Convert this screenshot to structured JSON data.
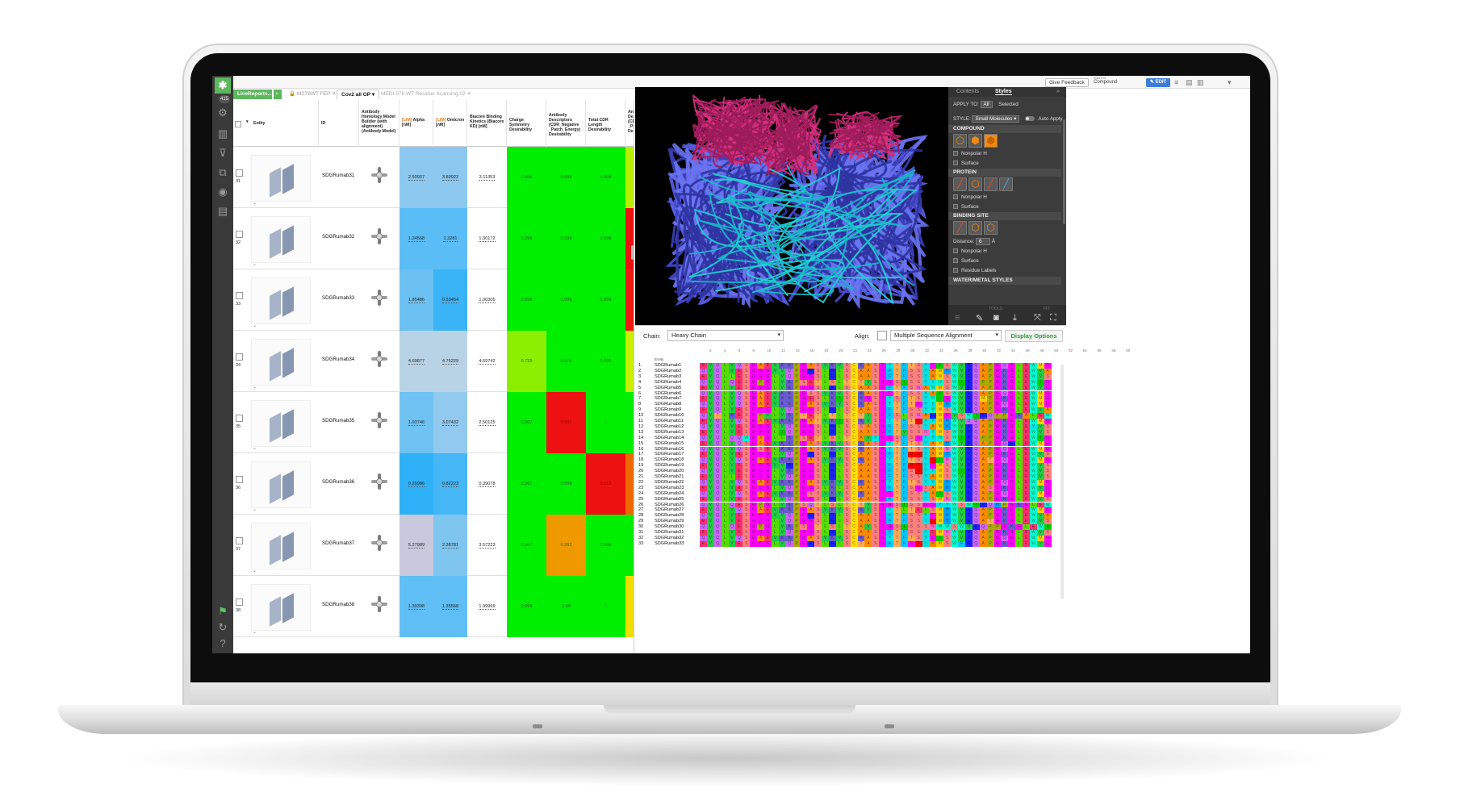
{
  "app": {
    "rail_badge": "415",
    "give_feedback": "Give Feedback",
    "row_for_label": "Row For",
    "row_for_value": "Compound",
    "edit_label": "✎ EDIT"
  },
  "tabs": [
    {
      "label": "LiveReports..."
    },
    {
      "label": "+"
    },
    {
      "label": "🔒 MS78WT FEP ✕"
    },
    {
      "label": "Cov2 all GP ▾"
    },
    {
      "label": "MEDI-578 WT Residue Scanning 02 ✕"
    }
  ],
  "table": {
    "columns": [
      {
        "label": "Entity"
      },
      {
        "label": "ID"
      },
      {
        "label": "Antibody Homology Model Builder (with alignment) (Antibody Model)"
      },
      {
        "label_hl": "[LiM]",
        "label": "Alpha [nM]"
      },
      {
        "label_hl": "[LiM]",
        "label": "Omicron [nM]"
      },
      {
        "label": "Biacore Binding Kinetics (Biacore KD) [nM]"
      },
      {
        "label": "Charge Symmetry Desirability"
      },
      {
        "label": "Antibody Descriptors (CDR_Negative _Patch_Energy) Desirability"
      },
      {
        "label": "Total CDR Length Desirability"
      },
      {
        "label": "Antibody Descriptors (CDR_Positive _Patch_Energy) Desirability"
      }
    ],
    "rows": [
      {
        "num": "31",
        "id": "SDGRumab31",
        "alpha": "2.50937",
        "omicron": "3.89922",
        "kd": "3.11353",
        "charge": "0.985",
        "neg": "0.885",
        "cdr": "0.998",
        "pos": "0.642",
        "c_alpha": "#8cc8f0",
        "c_omicron": "#8cc8f0",
        "c_charge": "#00ee00",
        "c_neg": "#00ee00",
        "c_cdr": "#00ee00",
        "c_pos": "#b8ee00"
      },
      {
        "num": "32",
        "id": "SDGRumab32",
        "alpha": "1.24568",
        "omicron": "1.3281",
        "kd": "1.30172",
        "charge": "0.996",
        "neg": "0.999",
        "cdr": "0.998",
        "pos": "0.01",
        "c_alpha": "#5bbdf5",
        "c_omicron": "#5bbdf5",
        "c_charge": "#00ee00",
        "c_neg": "#00ee00",
        "c_cdr": "#00ee00",
        "c_pos": "#ee1111"
      },
      {
        "num": "33",
        "id": "SDGRumab33",
        "alpha": "1.85486",
        "omicron": "0.53454",
        "kd": "1.00305",
        "charge": "0.996",
        "neg": "0.996",
        "cdr": "0.999",
        "pos": "0.087",
        "c_alpha": "#6bc1f2",
        "c_omicron": "#3ab4f7",
        "c_charge": "#00ee00",
        "c_neg": "#00ee00",
        "c_cdr": "#00ee00",
        "c_pos": "#ee1a11"
      },
      {
        "num": "34",
        "id": "SDGRumab34",
        "alpha": "4.69877",
        "omicron": "4.76229",
        "kd": "4.69742",
        "charge": "0.729",
        "neg": "0.976",
        "cdr": "0.996",
        "pos": "0.804",
        "c_alpha": "#b9d3e6",
        "c_omicron": "#b9d3e6",
        "c_charge": "#8cee00",
        "c_neg": "#00ee00",
        "c_cdr": "#00ee00",
        "c_pos": "#c8ee00"
      },
      {
        "num": "35",
        "id": "SDGRumab35",
        "alpha": "1.93746",
        "omicron": "3.07432",
        "kd": "2.50125",
        "charge": "0.967",
        "neg": "0.001",
        "cdr": "1",
        "pos": "0.983",
        "c_alpha": "#6fc2f2",
        "c_omicron": "#92c9ee",
        "c_charge": "#00ee00",
        "c_neg": "#ee1111",
        "c_cdr": "#00ee00",
        "c_pos": "#00ee00"
      },
      {
        "num": "36",
        "id": "SDGRumab36",
        "alpha": "0.29986",
        "omicron": "0.82223",
        "kd": "0.39078",
        "charge": "0.967",
        "neg": "0.898",
        "cdr": "0.012",
        "pos": "0.221",
        "c_alpha": "#2fb1f8",
        "c_omicron": "#45b7f6",
        "c_charge": "#00ee00",
        "c_neg": "#00ee00",
        "c_cdr": "#ee1111",
        "c_pos": "#ee6a00"
      },
      {
        "num": "37",
        "id": "SDGRumab37",
        "alpha": "5.27989",
        "omicron": "2.38781",
        "kd": "3.57223",
        "charge": "0.967",
        "neg": "0.292",
        "cdr": "0.995",
        "pos": "0.995",
        "c_alpha": "#c9c9de",
        "c_omicron": "#7ec5f0",
        "c_charge": "#00ee00",
        "c_neg": "#ee9900",
        "c_cdr": "#00ee00",
        "c_pos": "#00ee00"
      },
      {
        "num": "38",
        "id": "SDGRumab38",
        "alpha": "1.39398",
        "omicron": "1.35568",
        "kd": "1.99969",
        "charge": "0.999",
        "neg": "0.99",
        "cdr": "1",
        "pos": "0.424",
        "c_alpha": "#5fbef4",
        "c_omicron": "#5fbef4",
        "c_charge": "#00ee00",
        "c_neg": "#00ee00",
        "c_cdr": "#00ee00",
        "c_pos": "#eedd00"
      }
    ]
  },
  "panel": {
    "tab_contents": "Contents",
    "tab_styles": "Styles",
    "apply_to": "APPLY TO:",
    "apply_all": "All",
    "apply_selected": "Selected",
    "style_label": "STYLE:",
    "style_value": "Small Molecules ▾",
    "auto_apply": "Auto Apply",
    "sec_compound": "COMPOUND",
    "nonpolar_h": "Nonpolar H",
    "surface": "Surface",
    "sec_protein": "PROTEIN",
    "sec_binding": "BINDING SITE",
    "distance_label": "Distance:",
    "distance_value": "6",
    "distance_unit": "Å",
    "residue_labels": "Residue Labels",
    "sec_water": "WATER/METAL STYLES",
    "tools_label": "TOOLS:",
    "fit_label": "FIT:"
  },
  "sequence": {
    "chain_label": "Chain:",
    "chain_value": "Heavy Chain",
    "align_label": "Align:",
    "align_value": "Multiple Sequence Alignment",
    "display_options": "Display Options",
    "entity_header": "Entity",
    "ruler": [
      "2",
      "4",
      "6",
      "8",
      "10",
      "12",
      "14",
      "16",
      "18",
      "20",
      "22",
      "24",
      "26",
      "28",
      "30",
      "32",
      "34",
      "36",
      "38",
      "40",
      "42",
      "44",
      "46",
      "48",
      "50",
      "52",
      "54",
      "56",
      "58",
      "60"
    ],
    "palette": {
      "A": "#ff8c00",
      "C": "#ffe000",
      "D": "#ff0000",
      "E": "#ff3070",
      "F": "#00c8ff",
      "G": "#ff00ff",
      "H": "#00a0ff",
      "I": "#00cc00",
      "K": "#6a5acd",
      "L": "#55dd00",
      "M": "#ffd000",
      "N": "#ff66cc",
      "P": "#aaaa00",
      "Q": "#cc66ff",
      "R": "#1e22ff",
      "S": "#ff7f7f",
      "T": "#ffaa55",
      "V": "#22cc44",
      "W": "#00ffcc",
      "Y": "#00e5e5"
    },
    "rows": [
      {
        "n": "1",
        "name": "SDGRumab1",
        "seq": "EVQLVQSGAEVKKPGASVKVSCKASGYTFTSYGISWVRQAPGQGLEWMGWISAYNGNTNY"
      },
      {
        "n": "2",
        "name": "SDGRumab2",
        "seq": "QVQLVESGGGVVQPGRSLRLSCAASGFTFSSYAMHWVRQAPGKGLEWVAVISYDGSNKYY"
      },
      {
        "n": "3",
        "name": "SDGRumab3",
        "seq": "EVQLLESGGGLVQPGGSLRLSCAASGFTFSSYAMSWVRQAPGKGLEWVSAISGSGGSTYY"
      },
      {
        "n": "4",
        "name": "SDGRumab4",
        "seq": "QVQLQESGPGLVKPSETLSLTCTVSGGSISSYYWSWIRQPPGKGLEWIGYIYYSGSTNYN"
      },
      {
        "n": "5",
        "name": "SDGRumab5",
        "seq": "EVQLVESGGGLVKPGGSLRLSCAASGFTFSNAWMSWVRQAPGKGLEWVGRIKSKTDGGTT"
      },
      {
        "n": "6",
        "name": "SDGRumab6",
        "seq": "QVQLVQSGAEVKKPGSSVKVSCKASGGTFSSYAISWVRQAPGQGLEWMGGIIPIFGTANY"
      },
      {
        "n": "7",
        "name": "SDGRumab7",
        "seq": "EVQLVQSGAEVKKPGESLKISCKGSGYSFTSYWIGWVRQMPGKGLEWMGIIYPGDSDTRY"
      },
      {
        "n": "8",
        "name": "SDGRumab8",
        "seq": "QVQLVQSGAEVKKPGASVKVSCKASGYTFTGYYMHWVRQAPGQGLEWMGWINPNSGGTNY"
      },
      {
        "n": "9",
        "name": "SDGRumab9",
        "seq": "EVQLVESGGGLVQPGGSLRLSCAASGFTFSSYWMSWVRQAPGKGLEWVANIKQDGSEKYY"
      },
      {
        "n": "10",
        "name": "SDGRumab10",
        "seq": "QVTLKESGPVLVKPTETLTLTCTVSGFSLSNARMGVSWIRQPPGKALEWLAHIFSNDEKS"
      },
      {
        "n": "11",
        "name": "SDGRumab11",
        "seq": "EVQLVQSGAEVKKPGATVKISCKVSGYTFTDYYMHWVQQAPGKGLEWMGLVDPEDGETIY"
      },
      {
        "n": "12",
        "name": "SDGRumab12",
        "seq": "QVQLVESGGGLVQPGGSLRLSCSASGFTFSSYAMHWVRQAPGKGLEYVSAISSNGGSTYY"
      },
      {
        "n": "13",
        "name": "SDGRumab13",
        "seq": "EVQLVESGGGLIQPGGSLRLSCAASGFTVSSNYMSWVRQAPGKGLEWVSVIYSGGSTYYA"
      },
      {
        "n": "14",
        "name": "SDGRumab14",
        "seq": "QVQLQQWGAGLLKPSETLSLTCAVYGGSFSGYYWSWIRQPPGKGLEWIGEINHSGSTNYN"
      },
      {
        "n": "15",
        "name": "SDGRumab15",
        "seq": "EVQLVQSGAEVKKPGASVKVSCKASGYTFTSYAMHWVRQAPGQRLEWMGWINAGNGNTKY"
      },
      {
        "n": "16",
        "name": "SDGRumab16",
        "seq": "QVQLVQSGSELKKPGASVKVSCKASGYTFTSYAMNWVRQAPGQGLEWMGWINTNTGNPTY"
      },
      {
        "n": "17",
        "name": "SDGRumab17",
        "seq": "EVQLVESGGGLVQPGRSLRLSCAASGFTFDDYAMHWVRQAPGKGLEWVSGISWNSGSIGY"
      },
      {
        "n": "18",
        "name": "SDGRumab18",
        "seq": "QVQLVQSGAEVKKPGASVKVSCKASGYTFTSYDINWVRQATGQGLEWMGWMNPNSGNTGY"
      },
      {
        "n": "19",
        "name": "SDGRumab19",
        "seq": "EVQLVESGGGVVRPGGSLRLSCAASGFTFDDYGMSWVRQAPGKGLEWVSGINWNGGSTGY"
      },
      {
        "n": "20",
        "name": "SDGRumab20",
        "seq": "QVQLVESGGGLVKPGGSLRLSCAASGFTFSDYYMSWIRQAPGKGLEWVSYISSSGSTIYY"
      },
      {
        "n": "21",
        "name": "SDGRumab21",
        "seq": "EVQLLESGGGLVQPGGSLRLSCAASGFTFSSYAMSWVRQAPGKGLEWVSAIGTGGGTYYA"
      },
      {
        "n": "22",
        "name": "SDGRumab22",
        "seq": "QVQLVQSGAEVKKPGASVKVSCKASGYTFTSYYMHWVRQAPGQGLEWMGIINPSGGSTSY"
      },
      {
        "n": "23",
        "name": "SDGRumab23",
        "seq": "EVQLVESGGGLVQPGGSLKLSCAASGFTFSGSAMHWVRQASGKGLEWVGRIRSKANSYAT"
      },
      {
        "n": "24",
        "name": "SDGRumab24",
        "seq": "QVQLVQSGAEVKKPGSSVKVSCKASGGTFSSYAISWVRQAPGQGLEWMGRIIPILGIANY"
      },
      {
        "n": "25",
        "name": "SDGRumab25",
        "seq": "EVQLVESGGGLVQPGGSLRLSCAASGFTFSSYSMNWVRQAPGKGLEWVSYISSSSSTIYY"
      },
      {
        "n": "26",
        "name": "SDGRumab26",
        "seq": "QVQLQESGPGLVKPSQTLSLTCTVSGGSISSGGYYWSWIRQHPGKGLEWIGYIYYSGSTY"
      },
      {
        "n": "27",
        "name": "SDGRumab27",
        "seq": "EVQLVQSGAEVKKPGASVKVSCKVSGYTLTELSMHWVRQAPGKGLEWMGGFDPEDGETIY"
      },
      {
        "n": "28",
        "name": "SDGRumab28",
        "seq": "QVQLVESGGGVVQPGRSLRLSCAASGFTFSSYGMHWVRQAPGKGLEWVAVIWYDGSNKYY"
      },
      {
        "n": "29",
        "name": "SDGRumab29",
        "seq": "EVQLVESGGGLVQPGGSLRLSCAASGFTFSSYDMHWVRQATGKGLEWVSAIGTAGDTYYP"
      },
      {
        "n": "30",
        "name": "SDGRumab30",
        "seq": "QVQLQESGPGLVKPSGTLSLTCAVSGGSISSSNWWSWVRQPPGKGLEWIGEIYHSGSTNY"
      },
      {
        "n": "31",
        "name": "SDGRumab31",
        "seq": "EVQLVESGGGLVQPGGSLRLSCAASGFTFSSYEMNWVRQAPGKGLEWVSYISSSGSTIYY"
      },
      {
        "n": "32",
        "name": "SDGRumab32",
        "seq": "QVQLVQSGAEVKKPGASVKVSCKASGYTFTSYGISWVRQAPGQGLEWMGWISAYNGNTNY"
      },
      {
        "n": "33",
        "name": "SDGRumab33",
        "seq": "EVQLVESGGGLVQPGRSLRLSCTASGFTFGDYAMSWFRQAPGKGLEWVGFIRSKAYGGTT"
      }
    ]
  }
}
